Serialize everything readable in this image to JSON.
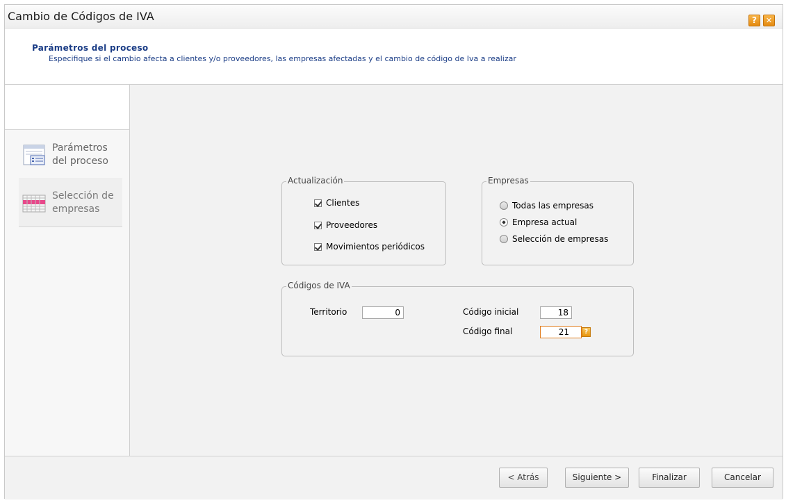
{
  "window": {
    "title": "Cambio de Códigos de IVA",
    "help_label": "?",
    "close_label": "✕"
  },
  "header": {
    "title": "Parámetros del proceso",
    "description": "Especifique si el cambio afecta a clientes y/o proveedores, las empresas afectadas y el cambio de código de Iva a realizar"
  },
  "sidebar": {
    "steps": [
      {
        "label_line1": "Parámetros",
        "label_line2": "del proceso",
        "icon": "form-icon"
      },
      {
        "label_line1": "Selección de",
        "label_line2": "empresas",
        "icon": "grid-icon"
      }
    ]
  },
  "actualizacion": {
    "legend": "Actualización",
    "options": [
      {
        "label": "Clientes",
        "checked": true
      },
      {
        "label": "Proveedores",
        "checked": true
      },
      {
        "label": "Movimientos periódicos",
        "checked": true
      }
    ]
  },
  "empresas": {
    "legend": "Empresas",
    "options": [
      {
        "label": "Todas las empresas",
        "selected": false
      },
      {
        "label": "Empresa actual",
        "selected": true
      },
      {
        "label": "Selección de empresas",
        "selected": false
      }
    ]
  },
  "codigos": {
    "legend": "Códigos de IVA",
    "territorio_label": "Territorio",
    "territorio_value": "0",
    "inicial_label": "Código inicial",
    "inicial_value": "18",
    "final_label": "Código final",
    "final_value": "21",
    "lookup_label": "?"
  },
  "footer": {
    "back_label": "< Atrás",
    "next_label": "Siguiente >",
    "finish_label": "Finalizar",
    "cancel_label": "Cancelar"
  },
  "colors": {
    "accent": "#1b3d86",
    "focus": "#e07b1a",
    "titlebar_button": "#e48a10"
  }
}
